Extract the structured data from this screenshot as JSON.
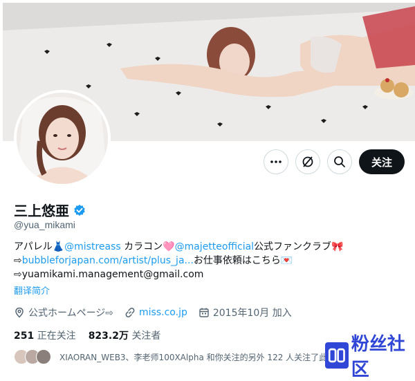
{
  "profile": {
    "display_name": "三上悠亜",
    "handle": "@yua_mikami",
    "bio_line1_prefix": "アパレル👗",
    "bio_line1_link1": "@mistreass",
    "bio_line1_mid": " カラコン🩷",
    "bio_line1_link2": "@majetteofficial",
    "bio_line1_suffix": "公式ファンクラブ🎀",
    "bio_line2_prefix": "⇨",
    "bio_line2_link": "bubbleforjapan.com/artist/plus_ja...",
    "bio_line2_suffix": "お仕事依頼はこちら💌",
    "bio_line3": "⇨yuamikami.management@gmail.com",
    "translate_label": "翻译简介",
    "website_label": "公式ホームページ⇨",
    "website_link": "miss.co.jp",
    "joined": "2015年10月 加入",
    "following_count": "251",
    "following_label": "正在关注",
    "followers_count": "823.2万",
    "followers_label": "关注者",
    "known_followers": "XIAORAN_WEB3、李老师100XAlpha 和你关注的另外 122 人关注了此"
  },
  "actions": {
    "more_icon": "more-horizontal-icon",
    "grok_icon": "grok-icon",
    "search_icon": "search-icon",
    "follow_label": "关注"
  },
  "watermark": {
    "text": "粉丝社区"
  },
  "colors": {
    "accent": "#1d9bf0",
    "text": "#0f1419",
    "muted": "#536471",
    "follow_bg": "#0f1419"
  }
}
